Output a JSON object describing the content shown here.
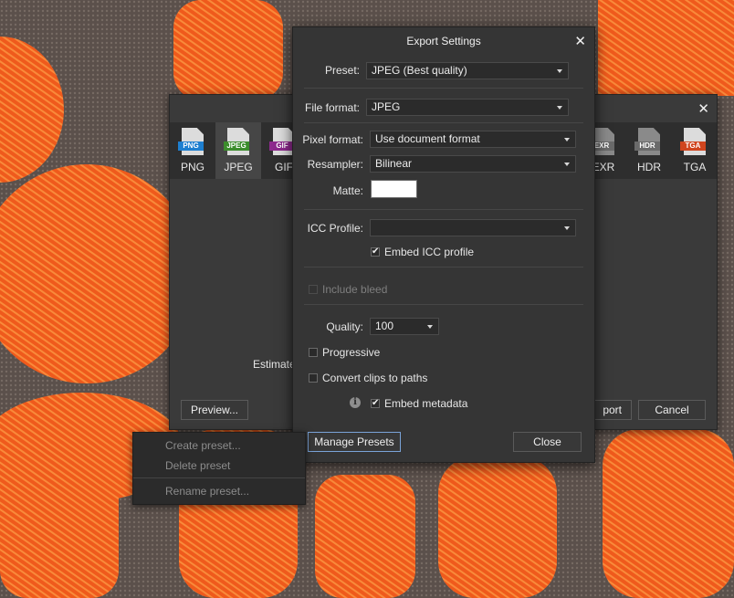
{
  "export_dialog": {
    "close_glyph": "✕",
    "formats": [
      {
        "label": "PNG",
        "tag": "PNG",
        "tag_color": "#1e7fd0"
      },
      {
        "label": "JPEG",
        "tag": "JPEG",
        "tag_color": "#3c8d2c"
      },
      {
        "label": "GIF",
        "tag": "GIF",
        "tag_color": "#8d2a8d"
      },
      {
        "label": "EXR",
        "tag": "EXR",
        "tag_color": "#6a6a6a"
      },
      {
        "label": "HDR",
        "tag": "HDR",
        "tag_color": "#6a6a6a"
      },
      {
        "label": "TGA",
        "tag": "TGA",
        "tag_color": "#d0451e"
      }
    ],
    "estimated_label": "Estimated",
    "preview_label": "Preview...",
    "export_label": "port",
    "cancel_label": "Cancel"
  },
  "settings": {
    "title": "Export Settings",
    "close_glyph": "✕",
    "preset_label": "Preset:",
    "preset_value": "JPEG (Best quality)",
    "file_format_label": "File format:",
    "file_format_value": "JPEG",
    "pixel_format_label": "Pixel format:",
    "pixel_format_value": "Use document format",
    "resampler_label": "Resampler:",
    "resampler_value": "Bilinear",
    "matte_label": "Matte:",
    "matte_color": "#ffffff",
    "icc_label": "ICC Profile:",
    "icc_value": "",
    "embed_icc_label": "Embed ICC profile",
    "embed_icc_checked": true,
    "include_bleed_label": "Include bleed",
    "include_bleed_checked": false,
    "quality_label": "Quality:",
    "quality_value": "100",
    "progressive_label": "Progressive",
    "progressive_checked": false,
    "convert_clips_label": "Convert clips to paths",
    "convert_clips_checked": false,
    "embed_metadata_label": "Embed metadata",
    "embed_metadata_checked": true,
    "info_glyph": "i",
    "check_glyph": "✔",
    "manage_presets_label": "Manage Presets",
    "close_label": "Close"
  },
  "context_menu": {
    "items": [
      "Create preset...",
      "Delete preset",
      "Rename preset..."
    ]
  }
}
